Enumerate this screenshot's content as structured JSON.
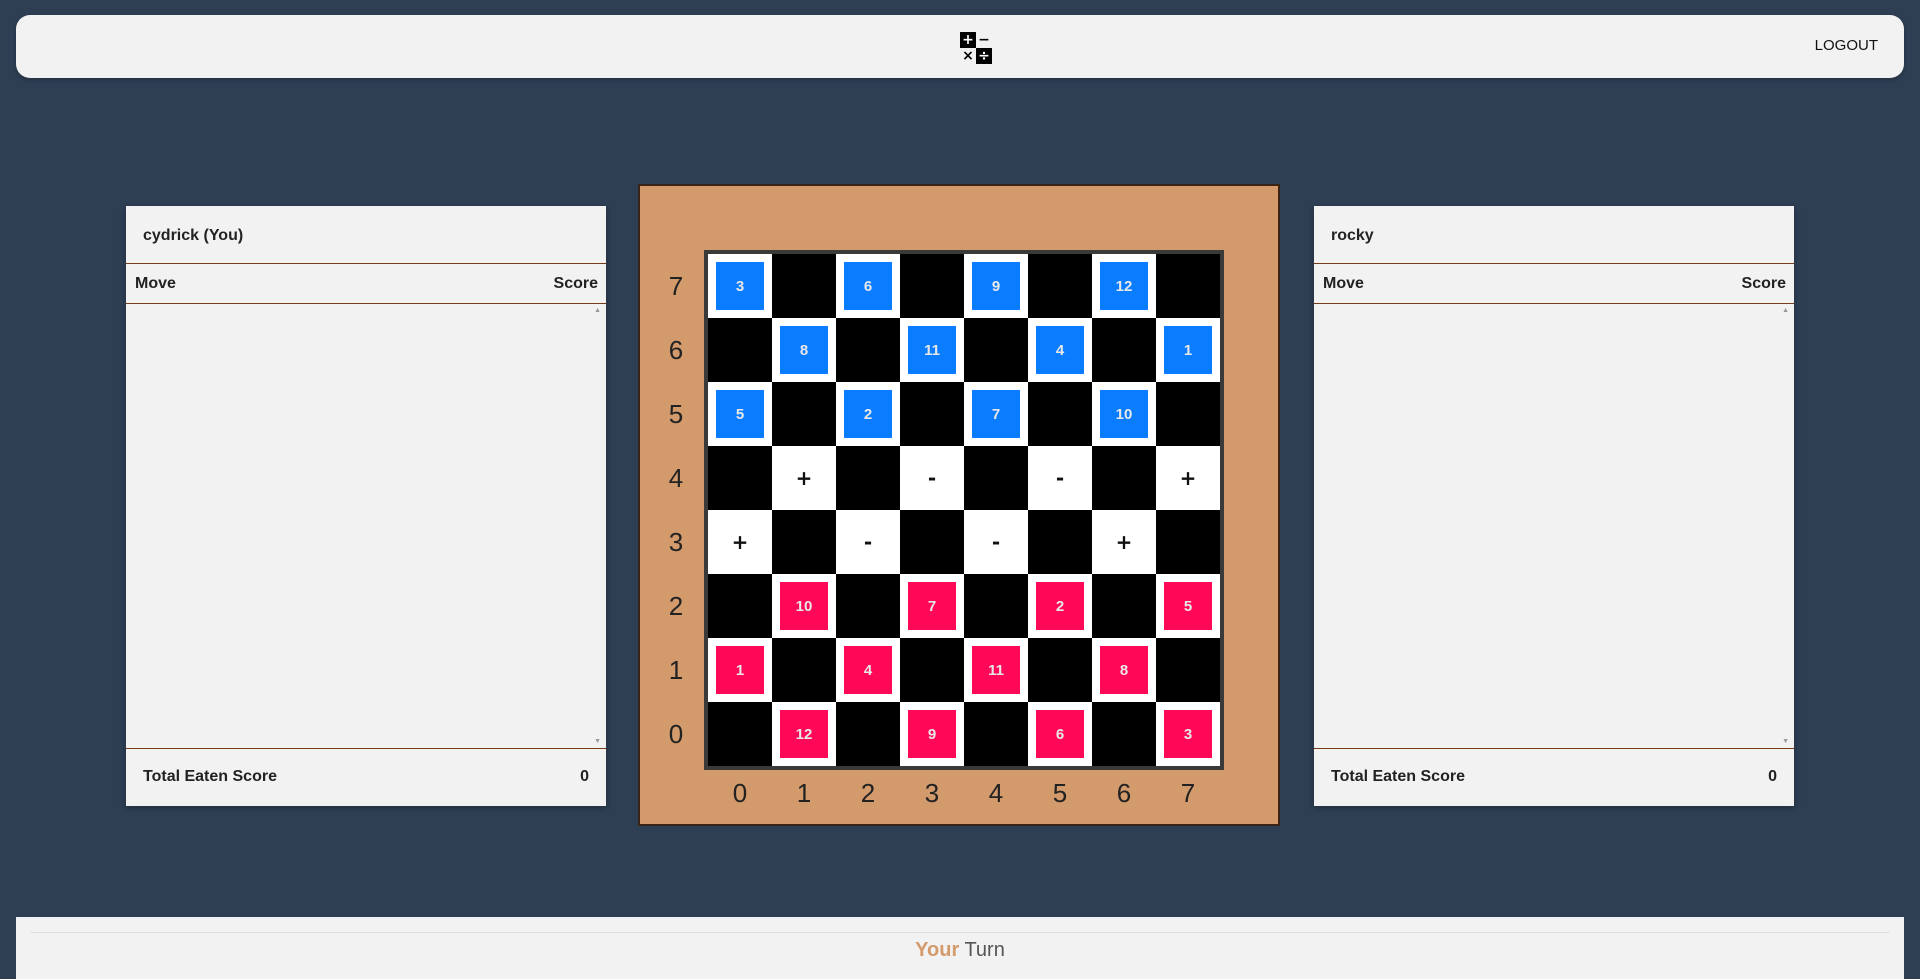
{
  "header": {
    "logo_symbols": [
      "+",
      "−",
      "×",
      "÷"
    ],
    "logout_label": "LOGOUT"
  },
  "players": {
    "left": {
      "name": "cydrick  (You)",
      "col_move": "Move",
      "col_score": "Score",
      "moves": [],
      "total_label": "Total Eaten Score",
      "total_value": "0"
    },
    "right": {
      "name": "rocky",
      "col_move": "Move",
      "col_score": "Score",
      "moves": [],
      "total_label": "Total Eaten Score",
      "total_value": "0"
    }
  },
  "board": {
    "ranks": [
      "7",
      "6",
      "5",
      "4",
      "3",
      "2",
      "1",
      "0"
    ],
    "files": [
      "0",
      "1",
      "2",
      "3",
      "4",
      "5",
      "6",
      "7"
    ],
    "colors": {
      "blue": "#0a7cff",
      "pink": "#ff0857",
      "frame": "#d39a6c"
    },
    "rows": [
      [
        {
          "p": "blue",
          "v": "3"
        },
        null,
        {
          "p": "blue",
          "v": "6"
        },
        null,
        {
          "p": "blue",
          "v": "9"
        },
        null,
        {
          "p": "blue",
          "v": "12"
        },
        null
      ],
      [
        null,
        {
          "p": "blue",
          "v": "8"
        },
        null,
        {
          "p": "blue",
          "v": "11"
        },
        null,
        {
          "p": "blue",
          "v": "4"
        },
        null,
        {
          "p": "blue",
          "v": "1"
        }
      ],
      [
        {
          "p": "blue",
          "v": "5"
        },
        null,
        {
          "p": "blue",
          "v": "2"
        },
        null,
        {
          "p": "blue",
          "v": "7"
        },
        null,
        {
          "p": "blue",
          "v": "10"
        },
        null
      ],
      [
        null,
        {
          "op": "+"
        },
        null,
        {
          "op": "-"
        },
        null,
        {
          "op": "-"
        },
        null,
        {
          "op": "+"
        }
      ],
      [
        {
          "op": "+"
        },
        null,
        {
          "op": "-"
        },
        null,
        {
          "op": "-"
        },
        null,
        {
          "op": "+"
        },
        null
      ],
      [
        null,
        {
          "p": "pink",
          "v": "10"
        },
        null,
        {
          "p": "pink",
          "v": "7"
        },
        null,
        {
          "p": "pink",
          "v": "2"
        },
        null,
        {
          "p": "pink",
          "v": "5"
        }
      ],
      [
        {
          "p": "pink",
          "v": "1"
        },
        null,
        {
          "p": "pink",
          "v": "4"
        },
        null,
        {
          "p": "pink",
          "v": "11"
        },
        null,
        {
          "p": "pink",
          "v": "8"
        },
        null
      ],
      [
        null,
        {
          "p": "pink",
          "v": "12"
        },
        null,
        {
          "p": "pink",
          "v": "9"
        },
        null,
        {
          "p": "pink",
          "v": "6"
        },
        null,
        {
          "p": "pink",
          "v": "3"
        }
      ]
    ]
  },
  "footer": {
    "turn_owner": "Your",
    "turn_text": " Turn"
  }
}
